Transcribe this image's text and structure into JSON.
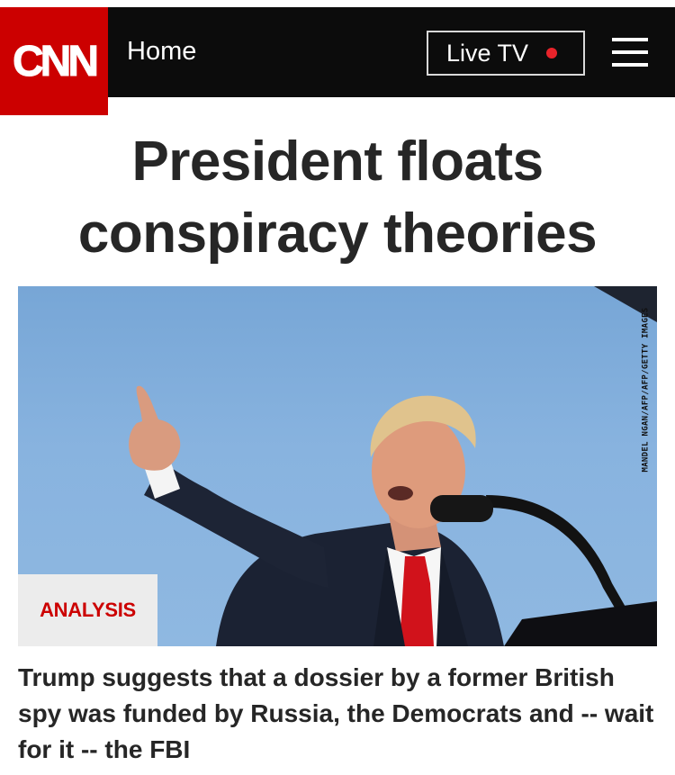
{
  "header": {
    "logo": "CNN",
    "home_label": "Home",
    "live_label": "Live TV",
    "colors": {
      "brand_red": "#cc0000",
      "bar": "#0c0c0c",
      "live_dot": "#e8232a"
    }
  },
  "article": {
    "headline_line1": "President floats",
    "headline_line2": "conspiracy theories",
    "image_credit": "MANDEL NGAN/AFP/AFP/GETTY IMAGES",
    "badge": "ANALYSIS",
    "summary": "Trump suggests that a dossier by a former British spy was funded by Russia, the Democrats and -- wait for it -- the FBI"
  },
  "icons": {
    "menu": "hamburger-menu-icon",
    "live": "live-dot-icon"
  }
}
